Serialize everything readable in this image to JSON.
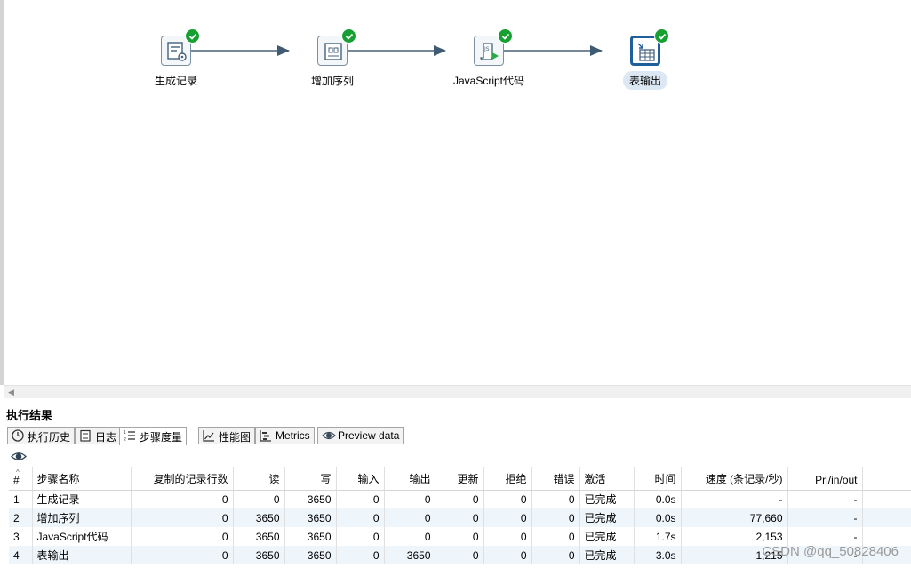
{
  "transformation": {
    "steps": [
      {
        "name": "生成记录",
        "icon": "generate-rows-icon",
        "status": "success"
      },
      {
        "name": "增加序列",
        "icon": "add-sequence-icon",
        "status": "success"
      },
      {
        "name": "JavaScript代码",
        "icon": "javascript-icon",
        "status": "success"
      },
      {
        "name": "表输出",
        "icon": "table-output-icon",
        "status": "success",
        "selected": true
      }
    ]
  },
  "results": {
    "title": "执行结果",
    "tabs": [
      {
        "label": "执行历史",
        "icon": "history-icon"
      },
      {
        "label": "日志",
        "icon": "log-icon"
      },
      {
        "label": "步骤度量",
        "icon": "step-metrics-icon",
        "active": true
      },
      {
        "label": "性能图",
        "icon": "performance-chart-icon"
      },
      {
        "label": "Metrics",
        "icon": "metrics-icon"
      },
      {
        "label": "Preview data",
        "icon": "preview-eye-icon"
      }
    ],
    "columns": [
      "#",
      "步骤名称",
      "复制的记录行数",
      "读",
      "写",
      "输入",
      "输出",
      "更新",
      "拒绝",
      "错误",
      "激活",
      "时间",
      "速度 (条记录/秒)",
      "Pri/in/out"
    ],
    "rows": [
      [
        "1",
        "生成记录",
        "0",
        "0",
        "3650",
        "0",
        "0",
        "0",
        "0",
        "0",
        "已完成",
        "0.0s",
        "-",
        "-"
      ],
      [
        "2",
        "增加序列",
        "0",
        "3650",
        "3650",
        "0",
        "0",
        "0",
        "0",
        "0",
        "已完成",
        "0.0s",
        "77,660",
        "-"
      ],
      [
        "3",
        "JavaScript代码",
        "0",
        "3650",
        "3650",
        "0",
        "0",
        "0",
        "0",
        "0",
        "已完成",
        "1.7s",
        "2,153",
        "-"
      ],
      [
        "4",
        "表输出",
        "0",
        "3650",
        "3650",
        "0",
        "3650",
        "0",
        "0",
        "0",
        "已完成",
        "3.0s",
        "1,215",
        "-"
      ]
    ]
  },
  "watermark": "CSDN @qq_50828406",
  "colors": {
    "accent": "#1f5f9c",
    "success": "#15a031",
    "alt_row": "#eef5fb"
  }
}
